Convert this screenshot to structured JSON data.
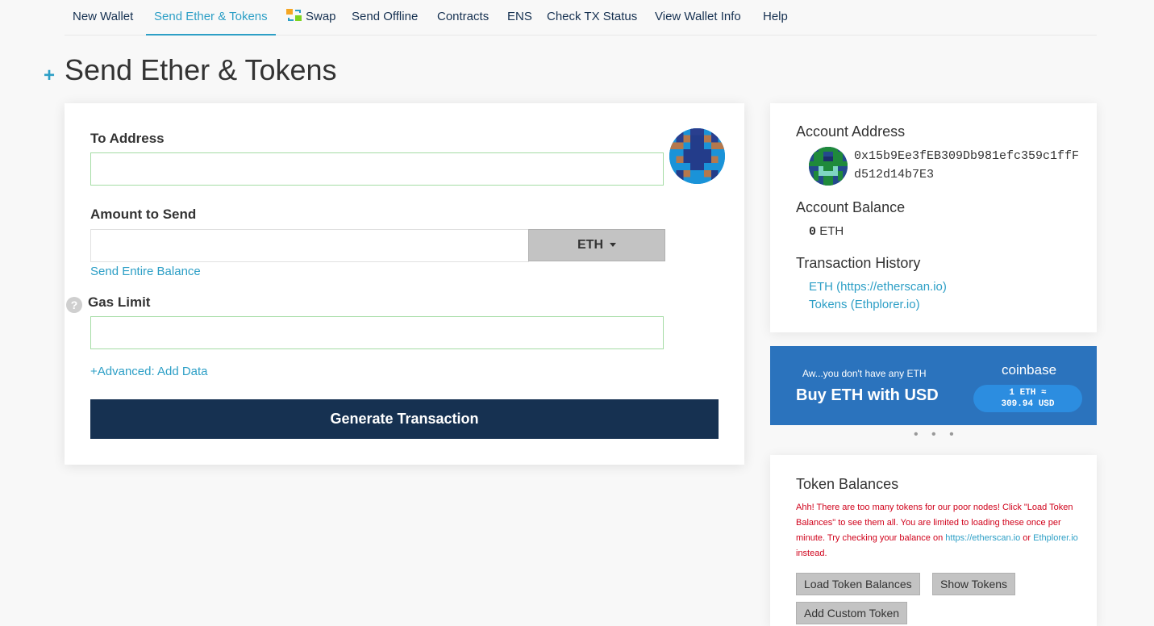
{
  "nav": {
    "items": [
      {
        "label": "New Wallet"
      },
      {
        "label": "Send Ether & Tokens"
      },
      {
        "label": "Swap"
      },
      {
        "label": "Send Offline"
      },
      {
        "label": "Contracts"
      },
      {
        "label": "ENS"
      },
      {
        "label": "Check TX Status"
      },
      {
        "label": "View Wallet Info"
      },
      {
        "label": "Help"
      }
    ],
    "active_index": 1
  },
  "page": {
    "title": "Send Ether & Tokens",
    "title_icon": "plus-icon"
  },
  "form": {
    "to_address_label": "To Address",
    "to_address_value": "",
    "amount_label": "Amount to Send",
    "amount_value": "",
    "currency": "ETH",
    "send_entire_balance": "Send Entire Balance",
    "gas_limit_label": "Gas Limit",
    "gas_limit_value": "",
    "advanced_link": "+Advanced: Add Data",
    "generate_button": "Generate Transaction"
  },
  "account": {
    "address_label": "Account Address",
    "address": "0x15b9Ee3fEB309Db981efc359c1ffFd512d14b7E3",
    "balance_label": "Account Balance",
    "balance_value": "0",
    "balance_unit": "ETH",
    "history_label": "Transaction History",
    "history_eth": "ETH (https://etherscan.io)",
    "history_tokens": "Tokens (Ethplorer.io)"
  },
  "promo": {
    "subtitle": "Aw...you don't have any ETH",
    "title": "Buy ETH with USD",
    "brand": "coinbase",
    "rate_line1": "1 ETH ≈",
    "rate_line2": "309.94 USD",
    "carousel_dots": "• • •"
  },
  "tokens": {
    "title": "Token Balances",
    "warning_part1": "Ahh! There are too many tokens for our poor nodes! Click \"Load Token Balances\" to see them all. You are limited to loading these once per minute. Try checking your balance on ",
    "warning_link1": "https://etherscan.io",
    "warning_part2": " or ",
    "warning_link2": "Ethplorer.io",
    "warning_part3": " instead.",
    "load_button": "Load Token Balances",
    "show_button": "Show Tokens",
    "add_button": "Add Custom Token"
  },
  "colors": {
    "accent": "#2d9fc6",
    "navy": "#163151",
    "promo_bg": "#2b73bd",
    "warning": "#d0021b"
  }
}
